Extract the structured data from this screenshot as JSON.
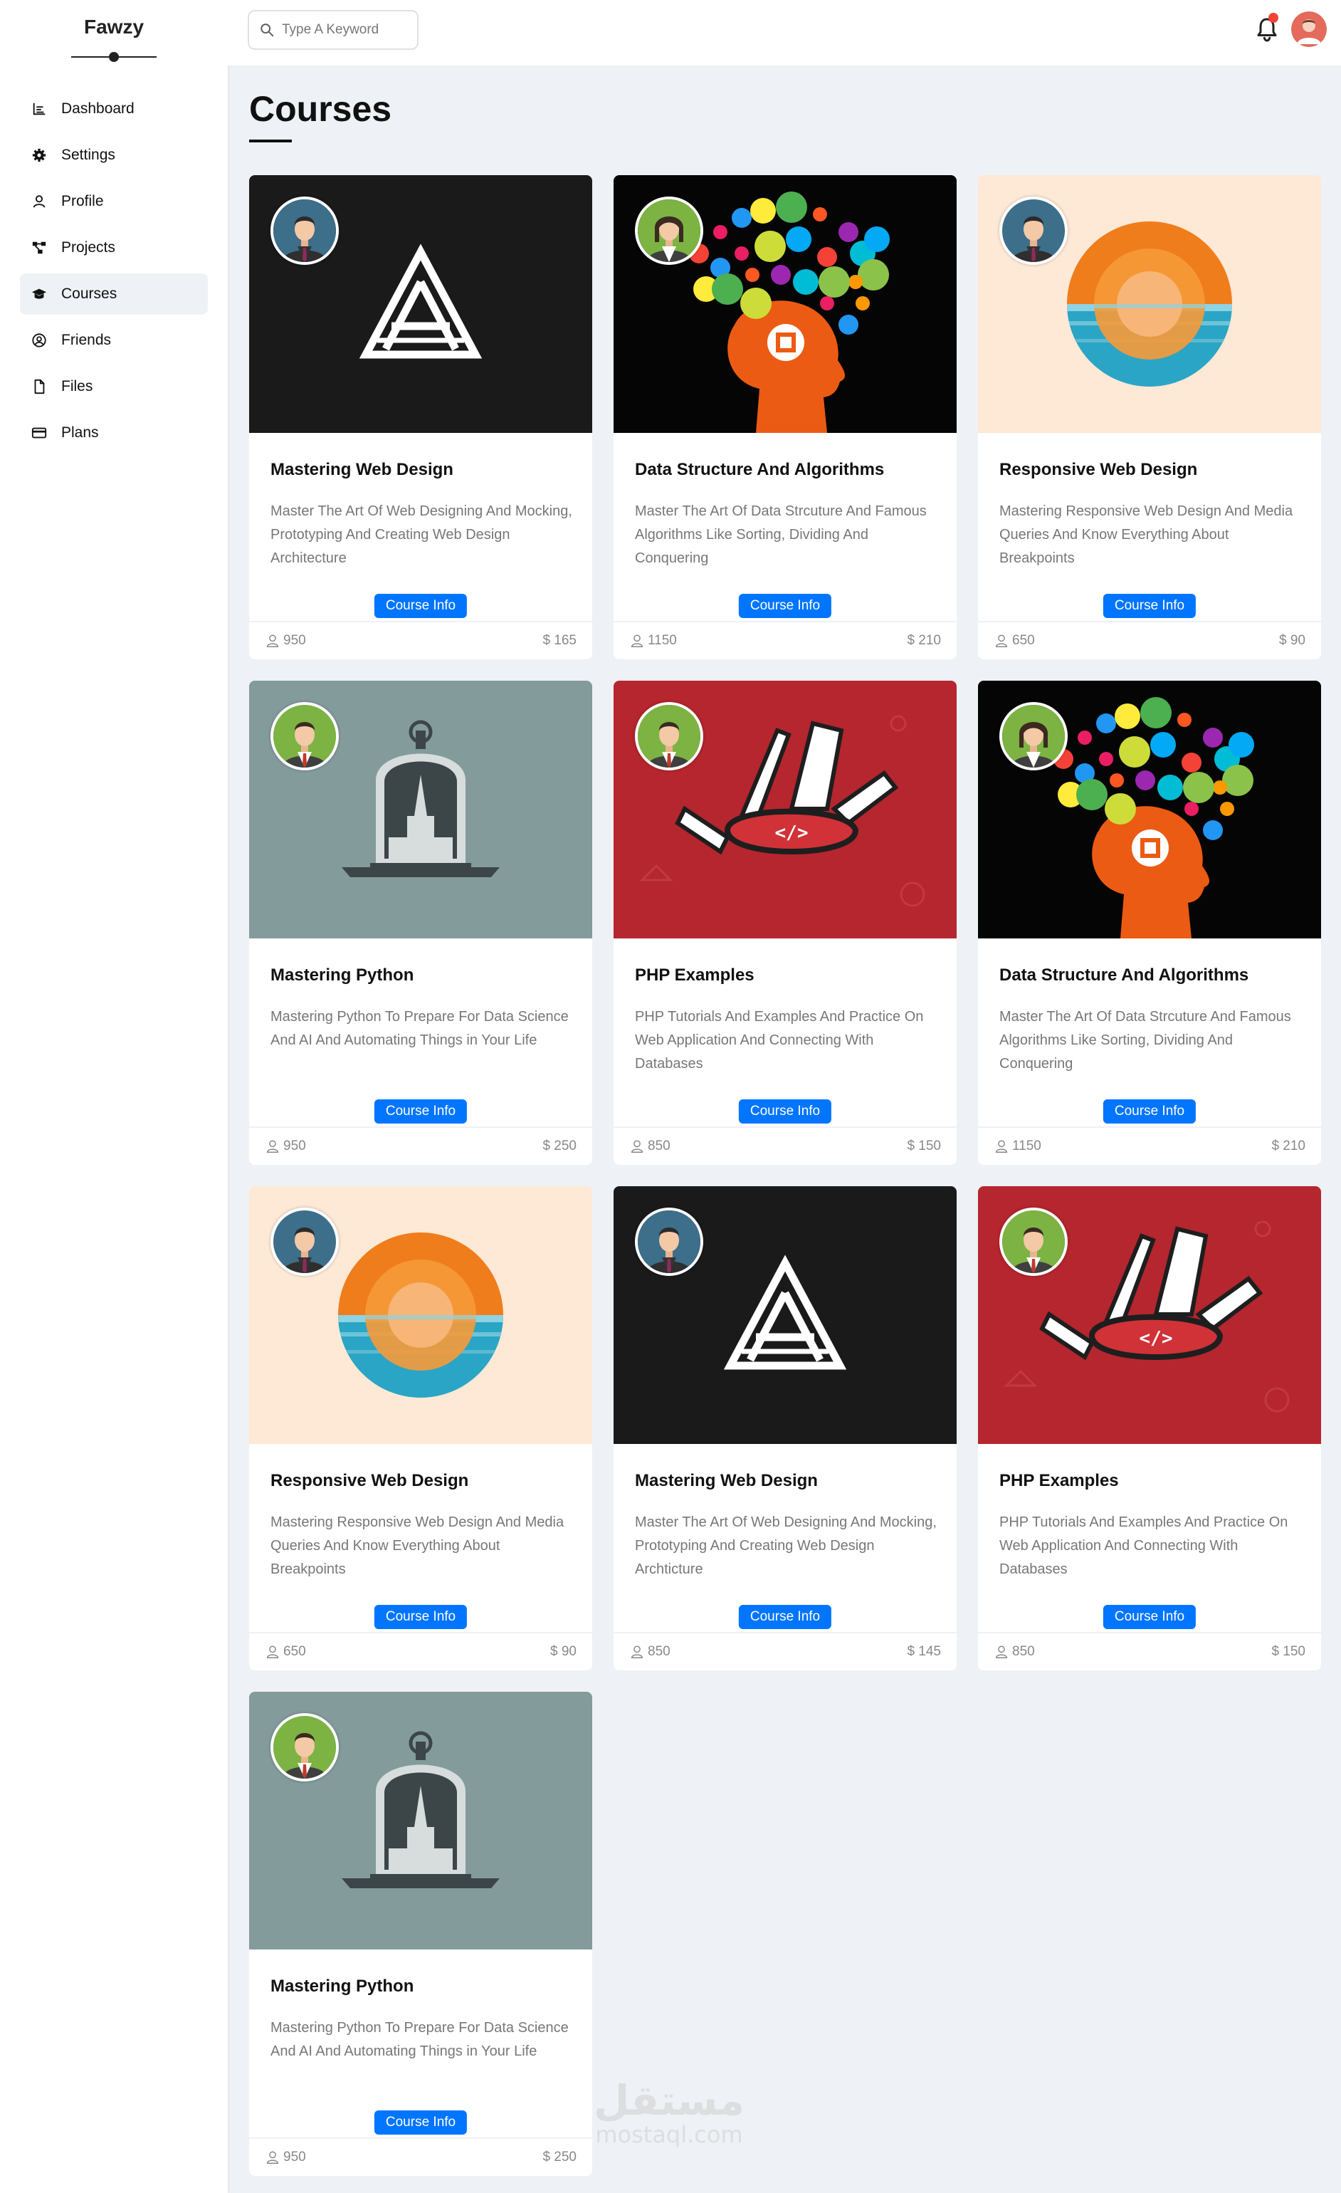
{
  "app": {
    "brand": "Fawzy"
  },
  "sidebar": {
    "items": [
      {
        "label": "Dashboard",
        "icon": "chart-icon"
      },
      {
        "label": "Settings",
        "icon": "gear-icon"
      },
      {
        "label": "Profile",
        "icon": "user-icon"
      },
      {
        "label": "Projects",
        "icon": "diagram-icon"
      },
      {
        "label": "Courses",
        "icon": "graduation-cap-icon",
        "active": true
      },
      {
        "label": "Friends",
        "icon": "user-circle-icon"
      },
      {
        "label": "Files",
        "icon": "file-icon"
      },
      {
        "label": "Plans",
        "icon": "credit-card-icon"
      }
    ]
  },
  "topbar": {
    "search_placeholder": "Type A Keyword",
    "notification_icon": "bell-icon",
    "has_notification": true
  },
  "page": {
    "title": "Courses"
  },
  "courses": [
    {
      "title": "Mastering Web Design",
      "desc": "Master The Art Of Web Designing And Mocking, Prototyping And Creating Web Design Architecture",
      "button": "Course Info",
      "students": "950",
      "price": "$ 165",
      "art": "logo-a",
      "avatar": "male-blue"
    },
    {
      "title": "Data Structure And Algorithms",
      "desc": "Master The Art Of Data Strcuture And Famous Algorithms Like Sorting, Dividing And Conquering",
      "button": "Course Info",
      "students": "1150",
      "price": "$ 210",
      "art": "brain",
      "avatar": "female-green"
    },
    {
      "title": "Responsive Web Design",
      "desc": "Mastering Responsive Web Design And Media Queries And Know Everything About Breakpoints",
      "button": "Course Info",
      "students": "650",
      "price": "$ 90",
      "art": "sun",
      "avatar": "male-blue"
    },
    {
      "title": "Mastering Python",
      "desc": "Mastering Python To Prepare For Data Science And AI And Automating Things in Your Life",
      "button": "Course Info",
      "students": "950",
      "price": "$ 250",
      "art": "jar",
      "avatar": "male-green"
    },
    {
      "title": "PHP Examples",
      "desc": "PHP Tutorials And Examples And Practice On Web Application And Connecting With Databases",
      "button": "Course Info",
      "students": "850",
      "price": "$ 150",
      "art": "knife",
      "avatar": "male-green"
    },
    {
      "title": "Data Structure And Algorithms",
      "desc": "Master The Art Of Data Strcuture And Famous Algorithms Like Sorting, Dividing And Conquering",
      "button": "Course Info",
      "students": "1150",
      "price": "$ 210",
      "art": "brain",
      "avatar": "female-green"
    },
    {
      "title": "Responsive Web Design",
      "desc": "Mastering Responsive Web Design And Media Queries And Know Everything About Breakpoints",
      "button": "Course Info",
      "students": "650",
      "price": "$ 90",
      "art": "sun",
      "avatar": "male-blue"
    },
    {
      "title": "Mastering Web Design",
      "desc": "Master The Art Of Web Designing And Mocking, Prototyping And Creating Web Design Archticture",
      "button": "Course Info",
      "students": "850",
      "price": "$ 145",
      "art": "logo-a",
      "avatar": "male-blue"
    },
    {
      "title": "PHP Examples",
      "desc": "PHP Tutorials And Examples And Practice On Web Application And Connecting With Databases",
      "button": "Course Info",
      "students": "850",
      "price": "$ 150",
      "art": "knife",
      "avatar": "male-green"
    },
    {
      "title": "Mastering Python",
      "desc": "Mastering Python To Prepare For Data Science And AI And Automating Things in Your Life",
      "button": "Course Info",
      "students": "950",
      "price": "$ 250",
      "art": "jar",
      "avatar": "male-green"
    }
  ],
  "watermark": {
    "arabic": "مستقل",
    "latin": "mostaql.com"
  },
  "colors": {
    "accent": "#0075ff",
    "background": "#eef1f5",
    "notification": "#f44336"
  }
}
